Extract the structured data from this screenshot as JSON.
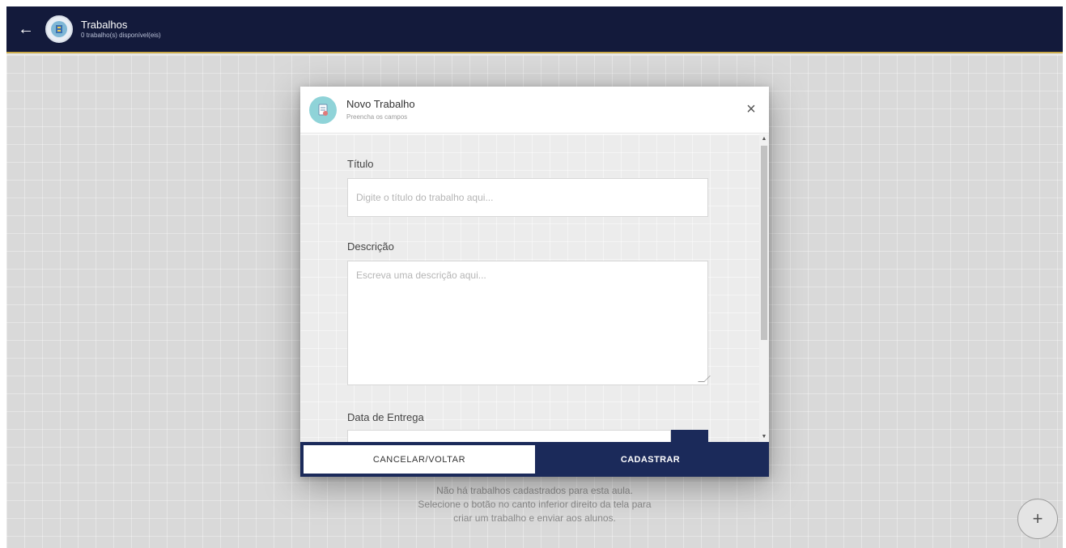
{
  "appbar": {
    "title": "Trabalhos",
    "subtitle": "0 trabalho(s) disponível(eis)",
    "back_icon": "arrow-left-icon"
  },
  "empty_state": {
    "line1": "Não há trabalhos cadastrados para esta aula.",
    "line2": "Selecione o botão no canto inferior direito da tela para",
    "line3": "criar um trabalho e enviar aos alunos."
  },
  "fab": {
    "label": "+"
  },
  "modal": {
    "title": "Novo Trabalho",
    "subtitle": "Preencha os campos",
    "close_label": "×",
    "fields": {
      "titulo": {
        "label": "Título",
        "placeholder": "Digite o título do trabalho aqui...",
        "value": ""
      },
      "descricao": {
        "label": "Descrição",
        "placeholder": "Escreva uma descrição aqui...",
        "value": ""
      },
      "data_entrega": {
        "label": "Data de Entrega",
        "value": ""
      }
    },
    "buttons": {
      "cancel": "CANCELAR/VOLTAR",
      "submit": "CADASTRAR"
    }
  },
  "colors": {
    "appbar_bg": "#131a3b",
    "accent_gold": "#c9a94a",
    "primary_navy": "#1b2a5a",
    "modal_icon_bg": "#8fd3d8"
  }
}
